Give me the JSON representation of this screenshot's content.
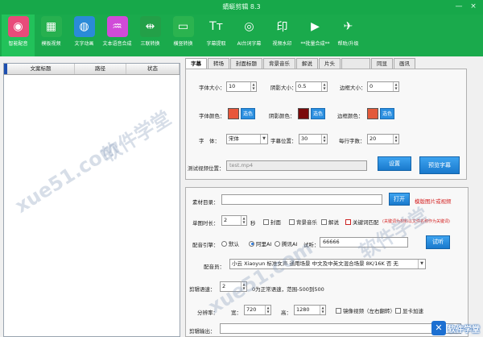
{
  "window": {
    "title": "蜻蜓剪辑 8.3",
    "min": "—",
    "close": "×"
  },
  "toolbar": [
    {
      "label": "智能配音",
      "icon": "smart-dub-icon",
      "glyph": "◉",
      "color": "#e84b7a"
    },
    {
      "label": "模板视频",
      "icon": "template-video-icon",
      "glyph": "▦",
      "color": "#27b04f"
    },
    {
      "label": "文字动画",
      "icon": "text-animation-icon",
      "glyph": "◍",
      "color": "#2a8bd8"
    },
    {
      "label": "文本语音合成",
      "icon": "tts-icon",
      "glyph": "♒",
      "color": "#d04bd8"
    },
    {
      "label": "三联转换",
      "icon": "triple-convert-icon",
      "glyph": "⇹",
      "color": "#23a048"
    },
    {
      "label": "横竖转换",
      "icon": "orientation-icon",
      "glyph": "▭",
      "color": "#2bb34f"
    },
    {
      "label": "字幕提取",
      "icon": "subtitle-extract-icon",
      "glyph": "Tт",
      "color": "#1aaa4c"
    },
    {
      "label": "AI台词字幕",
      "icon": "ai-subtitle-icon",
      "glyph": "◎",
      "color": "#1aaa4c"
    },
    {
      "label": "视频水印",
      "icon": "watermark-icon",
      "glyph": "印",
      "color": "#1aaa4c"
    },
    {
      "label": "**批量合成**",
      "icon": "batch-compose-icon",
      "glyph": "▶",
      "color": "#1aaa4c"
    },
    {
      "label": "帮助/升级",
      "icon": "help-upgrade-icon",
      "glyph": "✈",
      "color": "#1aaa4c"
    }
  ],
  "list": {
    "col_title": "文案标题",
    "col_path": "路径",
    "col_status": "状态"
  },
  "tabs": [
    "字幕",
    "转场",
    "封面标题",
    "背景音乐",
    "解说",
    "片头",
    "",
    "同显",
    "画讯"
  ],
  "subtitle": {
    "font_size_label": "字体大小：",
    "font_size": "10",
    "shadow_size_label": "阴影大小：",
    "shadow_size": "0.5",
    "border_size_label": "边框大小：",
    "border_size": "0",
    "font_color_label": "字体颜色：",
    "font_color": "#e8563a",
    "shadow_color_label": "阴影颜色：",
    "shadow_color": "#7a0a0a",
    "border_color_label": "边框颜色：",
    "border_color": "#e35a3a",
    "pick_label": "选色",
    "font_label": "字　体：",
    "font": "宋体",
    "position_label": "字幕位置：",
    "position": "30",
    "chars_label": "每行字数：",
    "chars": "20",
    "test_video_label": "测试视频位置：",
    "test_video": "test.mp4",
    "set_button": "设置",
    "preview_button": "预览字幕"
  },
  "material": {
    "dir_label": "素材目录：",
    "dir_value": "",
    "open_button": "打开",
    "dir_hint": "模版图片或视频",
    "duration_label": "单图时长：",
    "duration": "2",
    "sec": "秒",
    "cb_cover": "封面",
    "cb_bgm": "背景音乐",
    "cb_narr": "解说",
    "cb_keyword": "关键词匹配",
    "keyword_hint": "(关键词为材料以文件名称作为关键词)",
    "engine_label": "配音引擎：",
    "radio_default": "默认",
    "radio_ali": "阿里AI",
    "radio_tx": "腾讯AI",
    "audition_label": "试听：",
    "audition_value": "66666",
    "audition_button": "试听",
    "voice_label": "配音员：",
    "voice_value": "小云 Xiaoyun 标准女声 通用场景 中文及中英文混合场景 8K/16K 否 无",
    "speed_label": "剪辑语速：",
    "speed": "2",
    "speed_hint": "0为正常语速，范围-500到500",
    "res_label": "分辨率：",
    "width_label": "宽：",
    "width": "720",
    "height_label": "高：",
    "height": "1280",
    "cb_mirror": "镜像视频（左右翻转）",
    "cb_gpu": "显卡加速",
    "output_label": "剪辑输出："
  },
  "watermarks": [
    "软件学堂",
    "xue51.com",
    "软件学堂",
    "xue51.com"
  ],
  "brand": {
    "glyph": "✕",
    "text": "软件学堂"
  }
}
